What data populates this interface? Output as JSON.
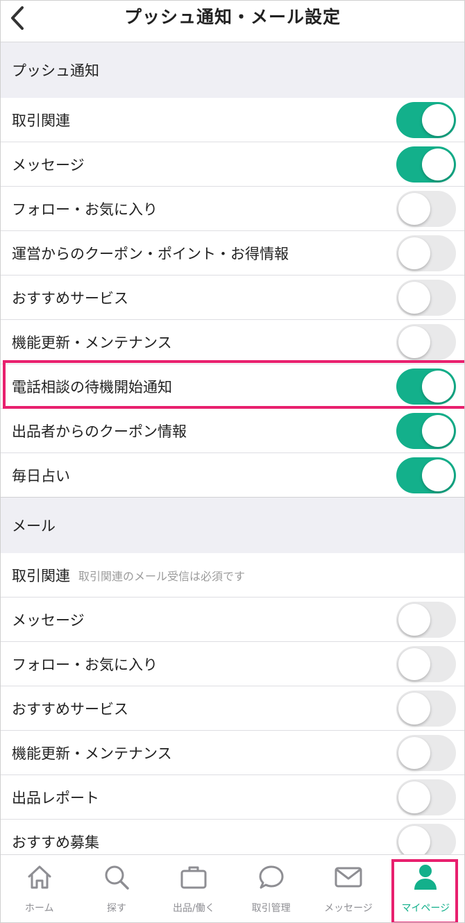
{
  "header": {
    "title": "プッシュ通知・メール設定"
  },
  "push": {
    "title": "プッシュ通知",
    "items": [
      {
        "label": "取引関連",
        "on": true
      },
      {
        "label": "メッセージ",
        "on": true
      },
      {
        "label": "フォロー・お気に入り",
        "on": false
      },
      {
        "label": "運営からのクーポン・ポイント・お得情報",
        "on": false
      },
      {
        "label": "おすすめサービス",
        "on": false
      },
      {
        "label": "機能更新・メンテナンス",
        "on": false
      },
      {
        "label": "電話相談の待機開始通知",
        "on": true
      },
      {
        "label": "出品者からのクーポン情報",
        "on": true
      },
      {
        "label": "毎日占い",
        "on": true
      }
    ]
  },
  "mail": {
    "title": "メール",
    "required": {
      "label": "取引関連",
      "note": "取引関連のメール受信は必須です"
    },
    "items": [
      {
        "label": "メッセージ",
        "on": false
      },
      {
        "label": "フォロー・お気に入り",
        "on": false
      },
      {
        "label": "おすすめサービス",
        "on": false
      },
      {
        "label": "機能更新・メンテナンス",
        "on": false
      },
      {
        "label": "出品レポート",
        "on": false
      },
      {
        "label": "おすすめ募集",
        "on": false
      }
    ]
  },
  "tabbar": {
    "items": [
      {
        "label": "ホーム",
        "icon": "home-icon"
      },
      {
        "label": "探す",
        "icon": "search-icon"
      },
      {
        "label": "出品/働く",
        "icon": "briefcase-icon"
      },
      {
        "label": "取引管理",
        "icon": "chat-bubble-icon"
      },
      {
        "label": "メッセージ",
        "icon": "envelope-icon"
      },
      {
        "label": "マイページ",
        "icon": "person-icon"
      }
    ],
    "active_index": 5
  },
  "colors": {
    "accent": "#13b08b",
    "highlight": "#e8206e",
    "toggle_off": "#e9e9ea"
  }
}
